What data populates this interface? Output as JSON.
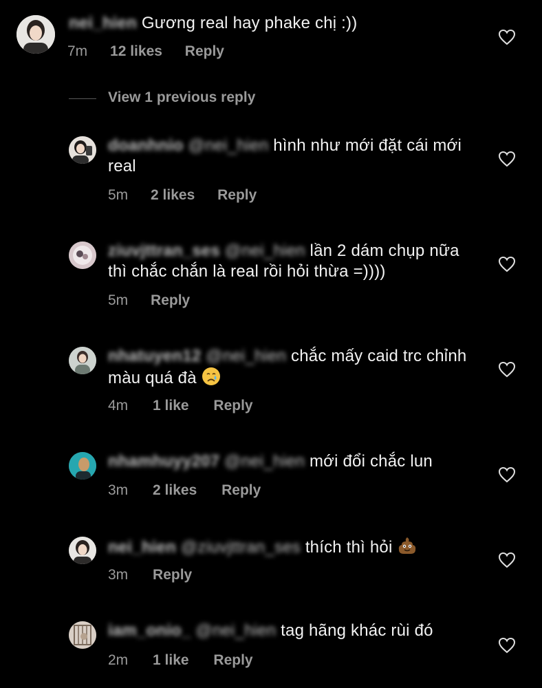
{
  "thread": {
    "view_previous_label": "View 1 previous reply",
    "colors": {
      "background": "#000000",
      "meta": "#9a9a9a",
      "text": "#f2f2f2"
    },
    "main_comment": {
      "username": "nei_hien",
      "text": "Gương real hay phake chị :))",
      "time": "7m",
      "likes": "12 likes",
      "reply": "Reply"
    },
    "replies": [
      {
        "username": "doanhnio",
        "mention": "@nei_hien",
        "text": "hình như mới đặt cái mới real",
        "time": "5m",
        "likes": "2 likes",
        "reply": "Reply"
      },
      {
        "username": "ziuvjttran_ses",
        "mention": "@nei_hien",
        "text": "lần 2 dám chụp nữa thì chắc chắn là real rồi hỏi thừa =))))",
        "time": "5m",
        "likes": "",
        "reply": "Reply"
      },
      {
        "username": "nhatuyen12",
        "mention": "@nei_hien",
        "text": "chắc mấy caid trc chỉnh màu quá đà",
        "emoji": "crying-face-icon",
        "time": "4m",
        "likes": "1 like",
        "reply": "Reply"
      },
      {
        "username": "nhamhuyy207",
        "mention": "@nei_hien",
        "text": "mới đổi chắc lun",
        "time": "3m",
        "likes": "2 likes",
        "reply": "Reply"
      },
      {
        "username": "nei_hien",
        "mention": "@ziuvjttran_ses",
        "text": "thích thì hỏi",
        "emoji": "poop-icon",
        "time": "3m",
        "likes": "",
        "reply": "Reply"
      },
      {
        "username": "iam_onio_",
        "mention": "@nei_hien",
        "text": "tag hãng khác rùi đó",
        "time": "2m",
        "likes": "1 like",
        "reply": "Reply"
      }
    ]
  }
}
